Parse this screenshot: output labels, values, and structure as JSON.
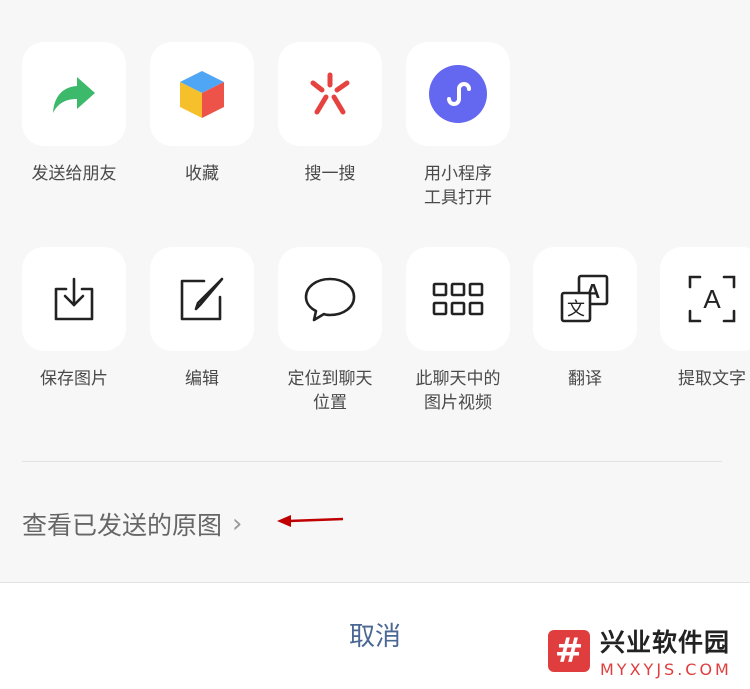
{
  "row1": [
    {
      "label": "发送给朋友",
      "icon": "share-arrow-icon"
    },
    {
      "label": "收藏",
      "icon": "favorite-cube-icon"
    },
    {
      "label": "搜一搜",
      "icon": "search-search-icon"
    },
    {
      "label": "用小程序\n工具打开",
      "icon": "mini-program-icon"
    }
  ],
  "row2": [
    {
      "label": "保存图片",
      "icon": "save-download-icon"
    },
    {
      "label": "编辑",
      "icon": "edit-icon"
    },
    {
      "label": "定位到聊天\n位置",
      "icon": "chat-bubble-icon"
    },
    {
      "label": "此聊天中的\n图片视频",
      "icon": "grid-icon"
    },
    {
      "label": "翻译",
      "icon": "translate-icon"
    },
    {
      "label": "提取文字",
      "icon": "extract-text-icon"
    }
  ],
  "view_original": {
    "label": "查看已发送的原图",
    "chevron": "›"
  },
  "cancel_label": "取消",
  "watermark": {
    "title": "兴业软件园",
    "url": "MYXYJS.COM",
    "logo": "#"
  },
  "colors": {
    "share": "#3cb96a",
    "search": "#e64340",
    "mini_program": "#6467f0",
    "cancel": "#4b6894",
    "arrow": "#c00000"
  }
}
